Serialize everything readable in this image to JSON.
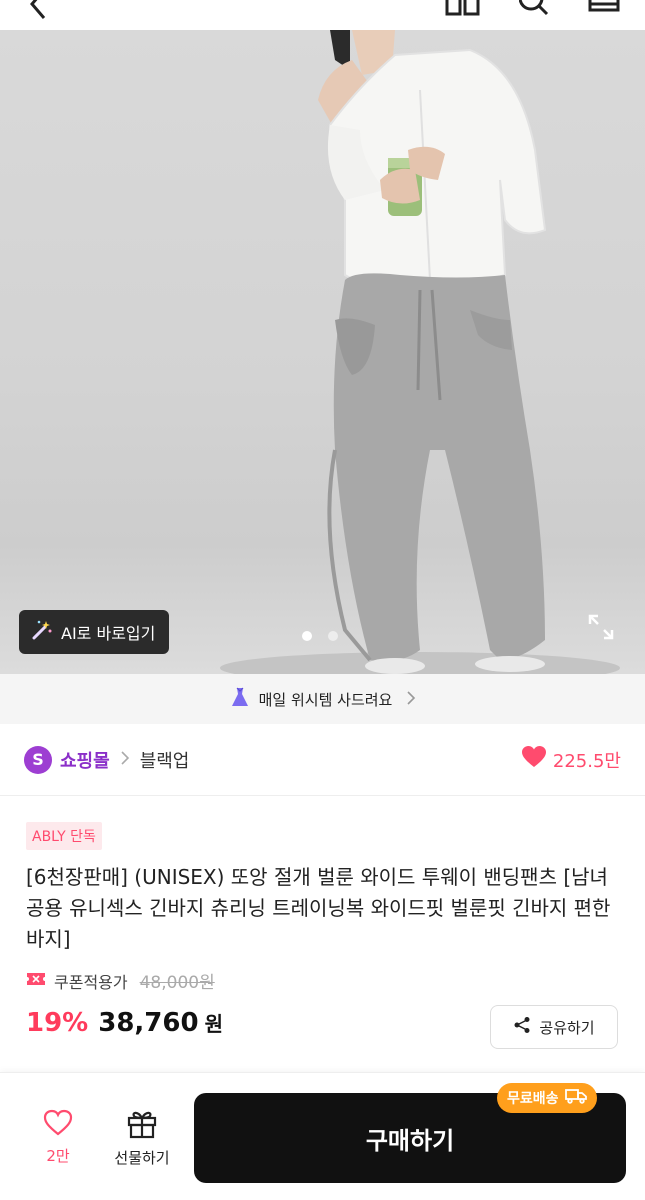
{
  "header": {
    "back_icon": "chevron-left-icon",
    "icons": [
      "grid-icon",
      "search-icon",
      "cart-icon"
    ]
  },
  "hero": {
    "ai_button_label": "AI로 바로입기",
    "ai_icon": "magic-wand-icon",
    "image_count": 2,
    "active_index": 0,
    "expand_icon": "expand-icon"
  },
  "wish_banner": {
    "icon": "dress-icon",
    "text": "매일 위시템 사드려요"
  },
  "store": {
    "badge": "S",
    "name": "쇼핑몰",
    "brand": "블랙업",
    "likes": "225.5만"
  },
  "product": {
    "exclusive_badge": "ABLY 단독",
    "title": "[6천장판매] (UNISEX) 또앙 절개 벌룬 와이드 투웨이 밴딩팬츠 [남녀공용 유니섹스 긴바지 츄리닝 트레이닝복 와이드핏 벌룬핏 긴바지 편한바지]",
    "coupon_label": "쿠폰적용가",
    "original_price": "48,000원",
    "discount": "19%",
    "price": "38,760",
    "currency": "원",
    "share_label": "공유하기"
  },
  "bottom_bar": {
    "wish_count": "2만",
    "gift_label": "선물하기",
    "buy_label": "구매하기",
    "free_shipping": "무료배송"
  },
  "colors": {
    "accent": "#ff4b6e",
    "store_purple": "#8b2fc9",
    "buy_button": "#111111",
    "free_ship": "#ff9f1c"
  }
}
